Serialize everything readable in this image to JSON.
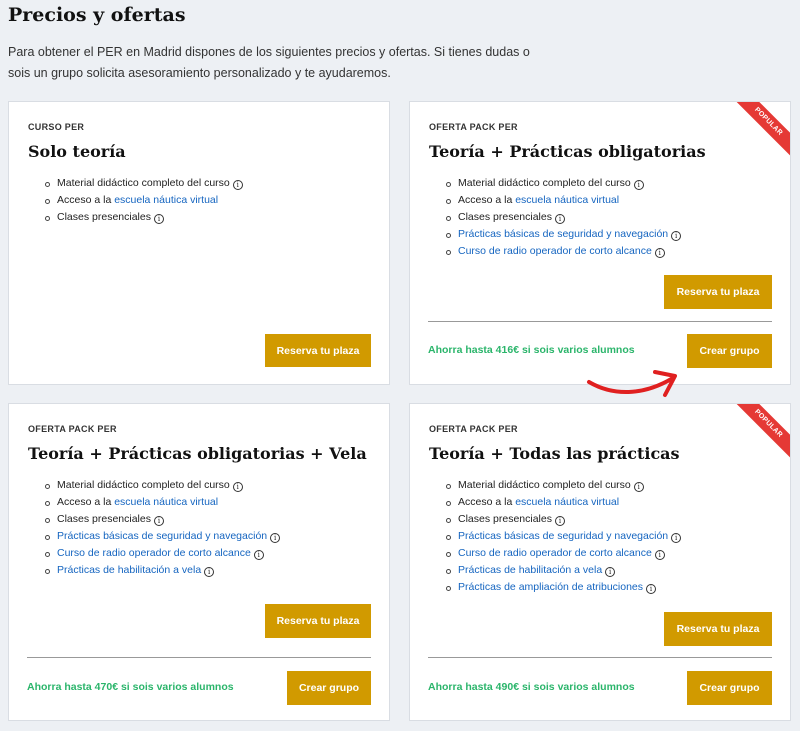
{
  "header": {
    "title": "Precios y ofertas",
    "intro": "Para obtener el PER en Madrid dispones de los siguientes precios y ofertas. Si tienes dudas o sois un grupo solicita asesoramiento personalizado y te ayudaremos."
  },
  "cards": [
    {
      "eyebrow": "CURSO PER",
      "title": "Solo teoría",
      "reserve_label": "Reserva tu plaza",
      "features": [
        {
          "text": "Material didáctico completo del curso",
          "link": false,
          "info": true
        },
        {
          "prefix": "Acceso a la ",
          "text": "escuela náutica virtual",
          "link": true,
          "info": false
        },
        {
          "text": "Clases presenciales",
          "link": false,
          "info": true
        }
      ]
    },
    {
      "eyebrow": "OFERTA PACK PER",
      "title": "Teoría + Prácticas obligatorias",
      "ribbon": "POPULAR",
      "reserve_label": "Reserva tu plaza",
      "savings": "Ahorra hasta 416€ si sois varios alumnos",
      "group_label": "Crear grupo",
      "features": [
        {
          "text": "Material didáctico completo del curso",
          "link": false,
          "info": true
        },
        {
          "prefix": "Acceso a la ",
          "text": "escuela náutica virtual",
          "link": true,
          "info": false
        },
        {
          "text": "Clases presenciales",
          "link": false,
          "info": true
        },
        {
          "text": "Prácticas básicas de seguridad y navegación",
          "link": true,
          "info": true
        },
        {
          "text": "Curso de radio operador de corto alcance",
          "link": true,
          "info": true
        }
      ]
    },
    {
      "eyebrow": "OFERTA PACK PER",
      "title": "Teoría + Prácticas obligatorias + Vela",
      "reserve_label": "Reserva tu plaza",
      "savings": "Ahorra hasta 470€ si sois varios alumnos",
      "group_label": "Crear grupo",
      "features": [
        {
          "text": "Material didáctico completo del curso",
          "link": false,
          "info": true
        },
        {
          "prefix": "Acceso a la ",
          "text": "escuela náutica virtual",
          "link": true,
          "info": false
        },
        {
          "text": "Clases presenciales",
          "link": false,
          "info": true
        },
        {
          "text": "Prácticas básicas de seguridad y navegación",
          "link": true,
          "info": true
        },
        {
          "text": "Curso de radio operador de corto alcance",
          "link": true,
          "info": true
        },
        {
          "text": "Prácticas de habilitación a vela",
          "link": true,
          "info": true
        }
      ]
    },
    {
      "eyebrow": "OFERTA PACK PER",
      "title": "Teoría + Todas las prácticas",
      "ribbon": "POPULAR",
      "reserve_label": "Reserva tu plaza",
      "savings": "Ahorra hasta 490€ si sois varios alumnos",
      "group_label": "Crear grupo",
      "features": [
        {
          "text": "Material didáctico completo del curso",
          "link": false,
          "info": true
        },
        {
          "prefix": "Acceso a la ",
          "text": "escuela náutica virtual",
          "link": true,
          "info": false
        },
        {
          "text": "Clases presenciales",
          "link": false,
          "info": true
        },
        {
          "text": "Prácticas básicas de seguridad y navegación",
          "link": true,
          "info": true
        },
        {
          "text": "Curso de radio operador de corto alcance",
          "link": true,
          "info": true
        },
        {
          "text": "Prácticas de habilitación a vela",
          "link": true,
          "info": true
        },
        {
          "text": "Prácticas de ampliación de atribuciones",
          "link": true,
          "info": true
        }
      ]
    }
  ],
  "colors": {
    "accent": "#d19a00",
    "savings": "#2bb56b",
    "link": "#1565c0",
    "ribbon": "#e53935",
    "arrow": "#e02020"
  }
}
